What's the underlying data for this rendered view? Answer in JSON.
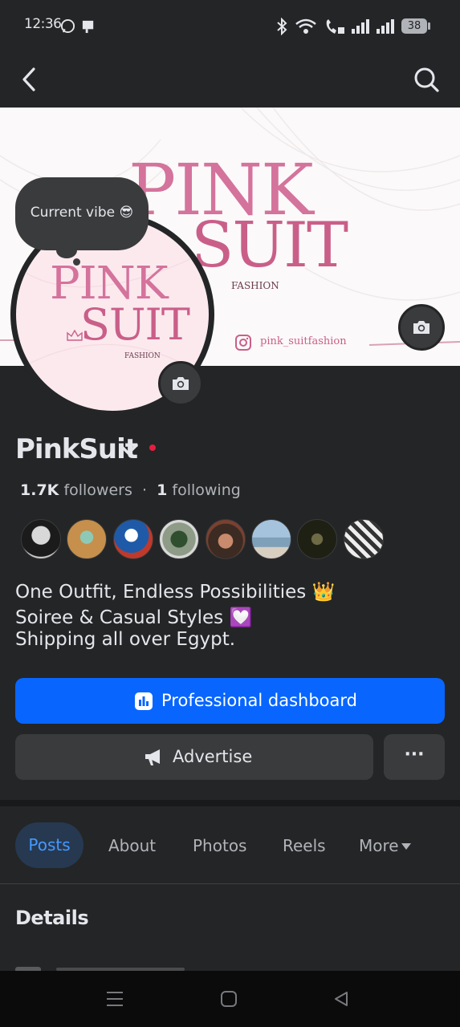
{
  "status_bar": {
    "time": "12:36",
    "battery": "38"
  },
  "cover": {
    "brand_line1": "PINK",
    "brand_line2": "SUIT",
    "brand_sub": "FASHION",
    "instagram": "pink_suitfashion"
  },
  "avatar": {
    "brand_line1": "PINK",
    "brand_line2": "SUIT",
    "brand_sub": "FASHION"
  },
  "note_bubble": "Current vibe 😎",
  "profile": {
    "name": "PinkSuit",
    "followers_count": "1.7K",
    "followers_label": "followers",
    "following_count": "1",
    "following_label": "following"
  },
  "bio": [
    "One Outfit, Endless Possibilities 👑",
    "Soiree & Casual Styles 💟",
    "Shipping all over Egypt."
  ],
  "buttons": {
    "dashboard": "Professional dashboard",
    "advertise": "Advertise",
    "more": "···"
  },
  "tabs": [
    "Posts",
    "About",
    "Photos",
    "Reels",
    "More"
  ],
  "details_heading": "Details",
  "colors": {
    "accent": "#0866ff",
    "background": "#242526",
    "surface": "#3a3b3c",
    "brand_pink": "#d4739c",
    "active_tab_bg": "#263951",
    "active_tab_text": "#4599ff"
  }
}
